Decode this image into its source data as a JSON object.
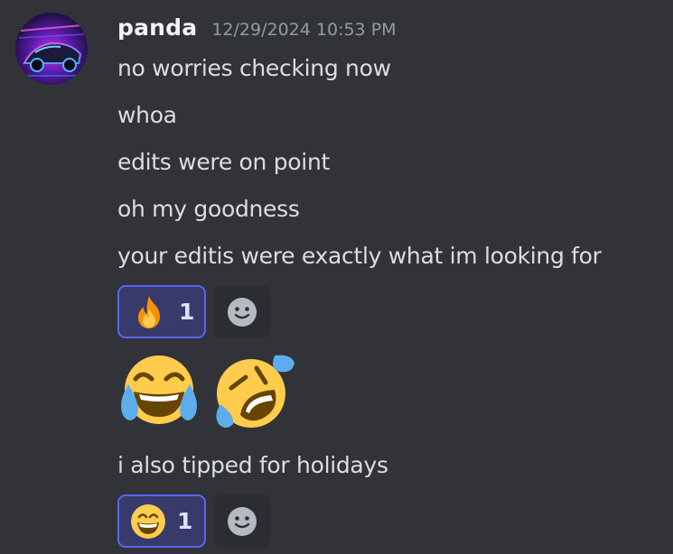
{
  "message": {
    "author": "panda",
    "timestamp": "12/29/2024 10:53 PM",
    "lines": [
      "no worries checking now",
      "whoa",
      "edits were on point",
      "oh my goodness",
      "your editis were exactly what im looking for"
    ],
    "reactions_1": [
      {
        "emoji": "fire-emoji",
        "count": "1",
        "selected": true
      }
    ],
    "jumbo_emojis": [
      "face-with-tears-of-joy-emoji",
      "rolling-on-the-floor-laughing-emoji"
    ],
    "line_after": "i also tipped for holidays",
    "reactions_2": [
      {
        "emoji": "grinning-face-with-smiling-eyes-emoji",
        "count": "1",
        "selected": true
      }
    ]
  },
  "colors": {
    "background": "#313338",
    "username": "#f2f3f5",
    "timestamp": "#949ba4",
    "text": "#dbdee1",
    "reaction_selected_border": "#5865f2",
    "reaction_selected_bg": "#373a6b"
  },
  "icons": {
    "add_reaction": "smiley-add-reaction-icon"
  }
}
